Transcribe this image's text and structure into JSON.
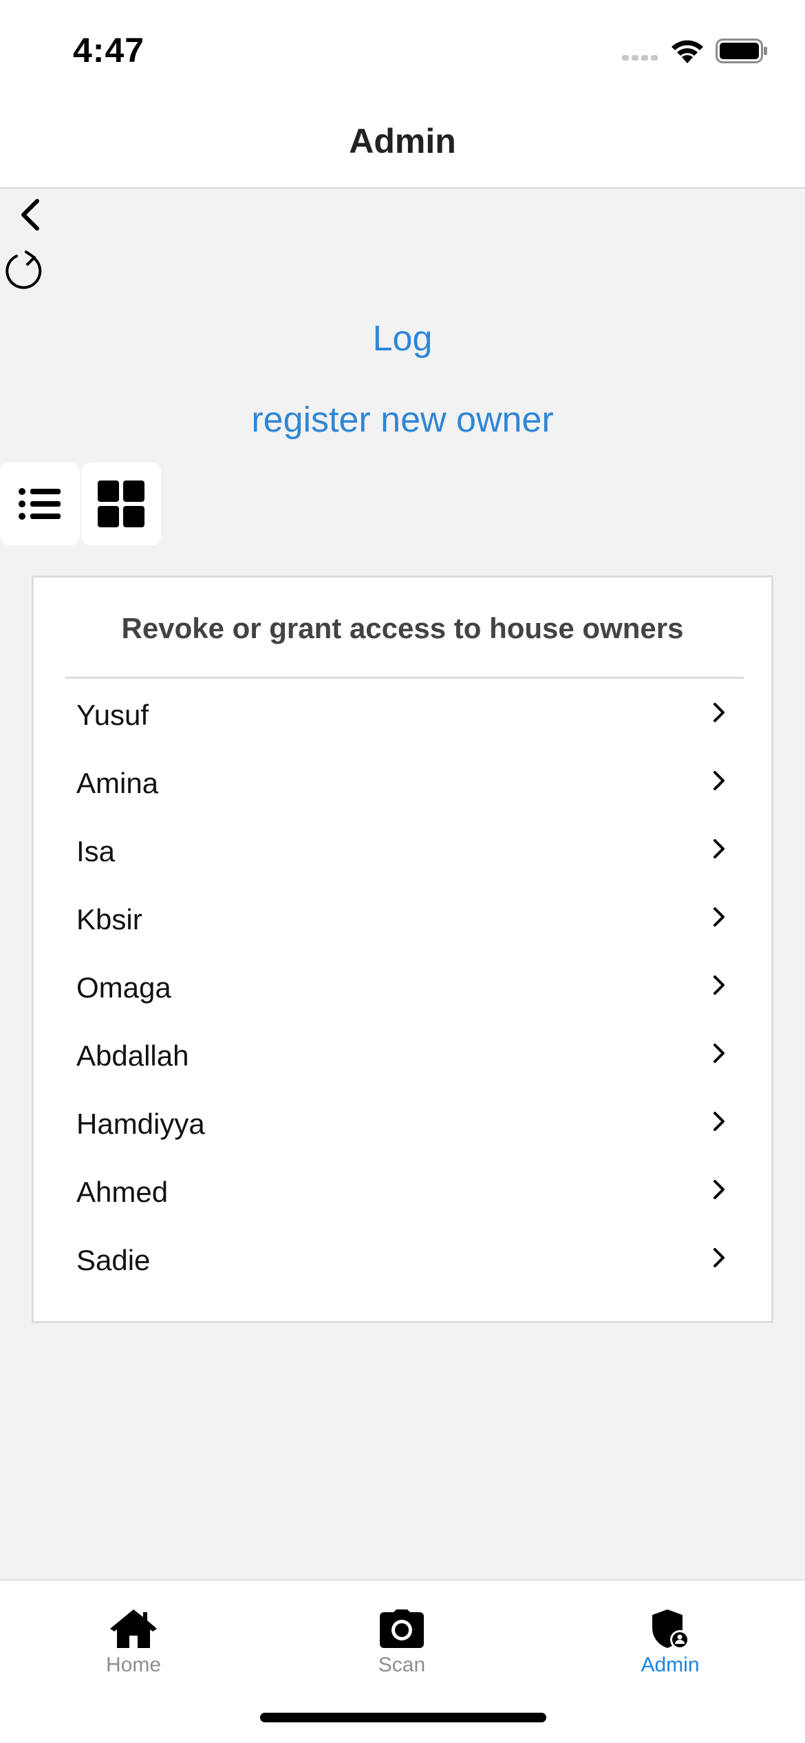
{
  "status_bar": {
    "time": "4:47"
  },
  "header": {
    "title": "Admin"
  },
  "actions": {
    "log_label": "Log",
    "register_label": "register new owner"
  },
  "card": {
    "title": "Revoke or grant access to house owners",
    "owners": [
      "Yusuf",
      "Amina",
      "Isa",
      "Kbsir",
      "Omaga",
      "Abdallah",
      "Hamdiyya",
      "Ahmed",
      "Sadie"
    ]
  },
  "tabs": [
    {
      "label": "Home",
      "icon": "home-icon",
      "active": false
    },
    {
      "label": "Scan",
      "icon": "camera-icon",
      "active": false
    },
    {
      "label": "Admin",
      "icon": "shield-user-icon",
      "active": true
    }
  ],
  "colors": {
    "accent": "#2f86d6",
    "tab_active": "#1a84e0",
    "tab_inactive": "#8e8e8e",
    "background": "#f2f2f2"
  }
}
